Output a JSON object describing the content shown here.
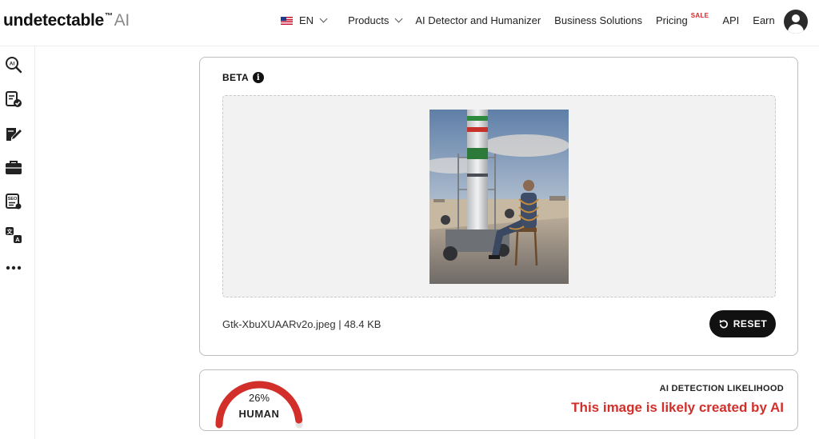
{
  "header": {
    "logo_text": "undetectable",
    "logo_tm": "™",
    "logo_ai": "AI",
    "nav": {
      "language": "EN",
      "products": "Products",
      "detector": "AI Detector and Humanizer",
      "business": "Business Solutions",
      "pricing": "Pricing",
      "sale_badge": "SALE",
      "api": "API",
      "earn": "Earn"
    }
  },
  "sidebar": {
    "items": [
      {
        "icon": "ai-search-icon"
      },
      {
        "icon": "document-check-icon"
      },
      {
        "icon": "edit-note-icon"
      },
      {
        "icon": "briefcase-icon"
      },
      {
        "icon": "seo-icon"
      },
      {
        "icon": "translate-icon"
      },
      {
        "icon": "more-dots-icon"
      }
    ]
  },
  "upload": {
    "beta_label": "BETA",
    "info_glyph": "i",
    "file_info": "Gtk-XbuXUAARv2o.jpeg | 48.4 KB",
    "reset_label": "RESET"
  },
  "result": {
    "percent": "26%",
    "percent_value": 26,
    "classification": "HUMAN",
    "likelihood_title": "AI DETECTION LIKELIHOOD",
    "verdict": "This image is likely created by AI"
  },
  "colors": {
    "accent_red": "#d22f2a",
    "button_dark": "#111111",
    "card_border": "#bdbdbd"
  }
}
